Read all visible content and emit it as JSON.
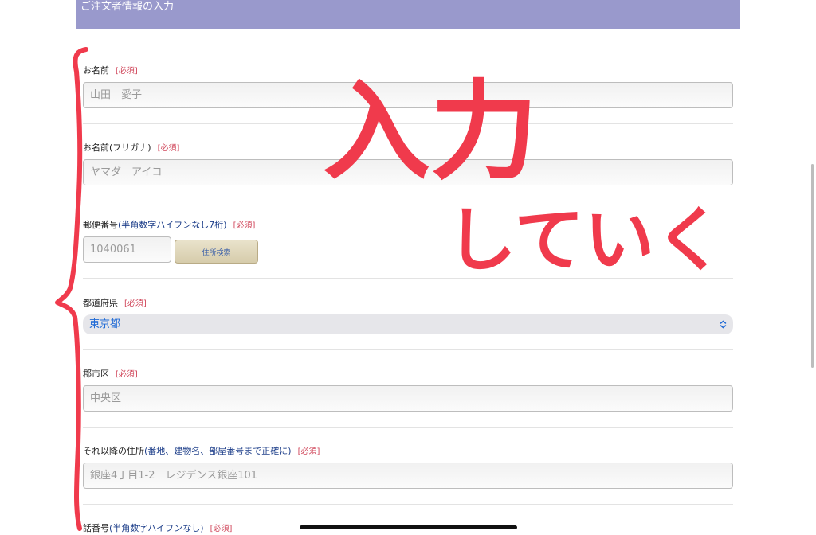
{
  "header": {
    "title": "ご注文者情報の入力"
  },
  "fields": {
    "name": {
      "label": "お名前",
      "required": "[必須]",
      "placeholder": "山田　愛子"
    },
    "kana": {
      "label": "お名前(フリガナ)",
      "required": "[必須]",
      "placeholder": "ヤマダ　アイコ"
    },
    "zip": {
      "label": "郵便番号",
      "hint": "(半角数字ハイフンなし7桁)",
      "required": "[必須]",
      "placeholder": "1040061",
      "button": "住所検索"
    },
    "prefecture": {
      "label": "都道府県",
      "required": "[必須]",
      "value": "東京都"
    },
    "city": {
      "label": "郡市区",
      "required": "[必須]",
      "placeholder": "中央区"
    },
    "address": {
      "label": "それ以降の住所",
      "hint": "(番地、建物名、部屋番号まで正確に)",
      "required": "[必須]",
      "placeholder": "銀座4丁目1-2　レジデンス銀座101"
    },
    "phone": {
      "label": "話番号",
      "hint": "(半角数字ハイフンなし)",
      "required": "[必須]"
    }
  },
  "annotation": {
    "line1": "入力",
    "line2": "していく",
    "color": "#f03a4c"
  },
  "colors": {
    "header_bg": "#9999cc",
    "required": "#d0465a",
    "select_text": "#1f6ad6"
  }
}
